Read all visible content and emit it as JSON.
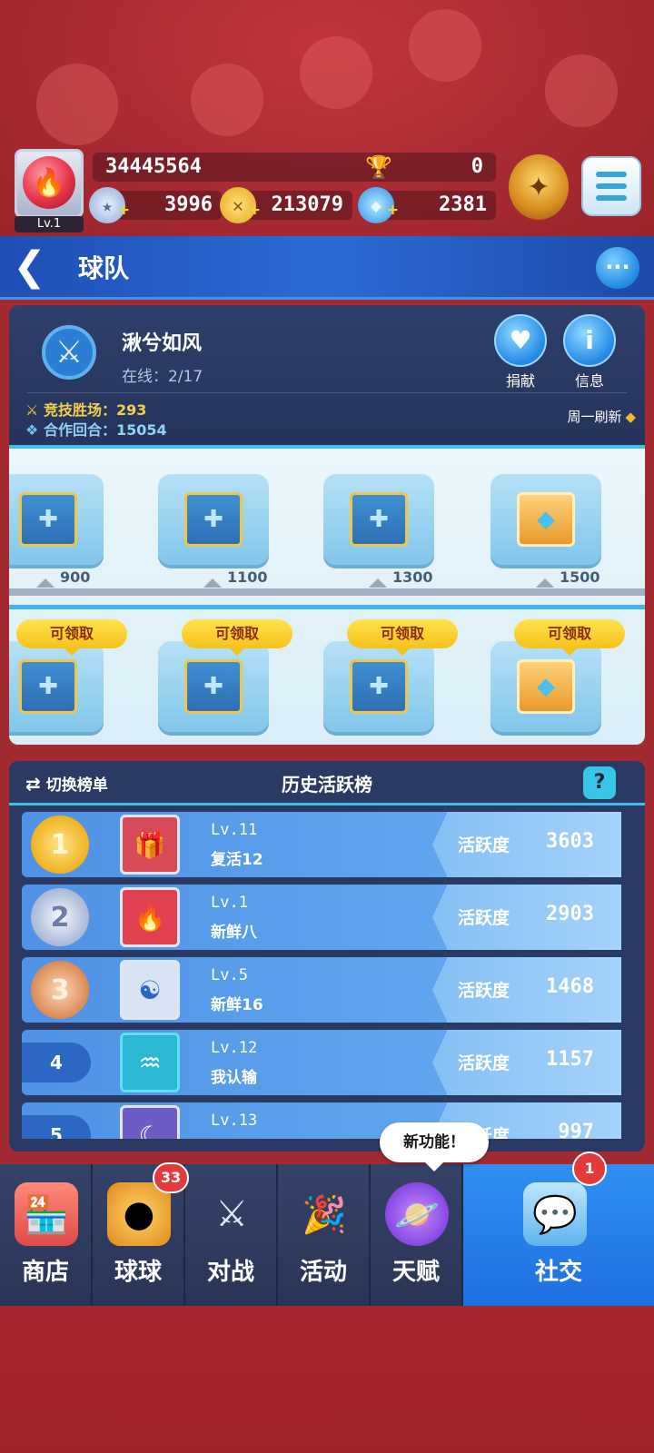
{
  "player": {
    "level": "Lv.1",
    "id": "34445564",
    "trophies": "0",
    "stars": "3996",
    "coins": "213079",
    "diamonds": "2381"
  },
  "header": {
    "title": "球队"
  },
  "team": {
    "name": "湫兮如风",
    "online": "在线：2/17",
    "arena_wins": "竞技胜场：293",
    "coop_rounds": "合作回合：15054",
    "refresh": "周一刷新",
    "donate_label": "捐献",
    "info_label": "信息"
  },
  "rewards": {
    "claim_label": "可领取",
    "thresholds": [
      "900",
      "1100",
      "1300",
      "1500"
    ]
  },
  "board": {
    "switch_label": "切换榜单",
    "title": "历史活跃榜",
    "score_label": "活跃度",
    "rows": [
      {
        "rank": "1",
        "level": "Lv.11",
        "name": "复活12",
        "score": "3603"
      },
      {
        "rank": "2",
        "level": "Lv.1",
        "name": "新鲜八",
        "score": "2903"
      },
      {
        "rank": "3",
        "level": "Lv.5",
        "name": "新鲜16",
        "score": "1468"
      },
      {
        "rank": "4",
        "level": "Lv.12",
        "name": "我认输",
        "score": "1157"
      },
      {
        "rank": "5",
        "level": "Lv.13",
        "name": "",
        "score": "997"
      }
    ]
  },
  "nav": {
    "items": [
      {
        "label": "商店"
      },
      {
        "label": "球球",
        "badge": "33"
      },
      {
        "label": "对战"
      },
      {
        "label": "活动"
      },
      {
        "label": "天赋"
      },
      {
        "label": "社交",
        "badge": "1"
      }
    ],
    "new_feature_tip": "新功能！"
  },
  "colors": {
    "background": "#a32a31",
    "header": "#2b6ad6",
    "panel": "#2b3a63",
    "claim": "#f7c21a",
    "active_tab": "#1f6fe0"
  }
}
